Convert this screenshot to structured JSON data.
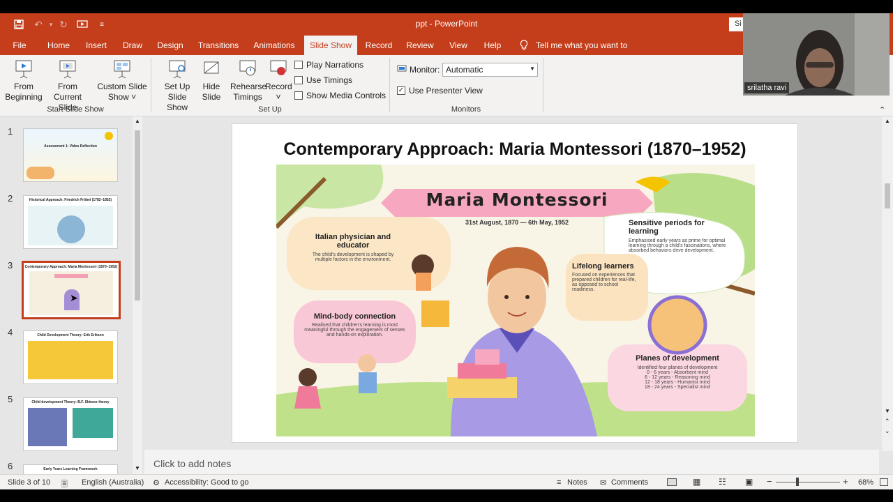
{
  "window": {
    "title": "ppt  -  PowerPoint",
    "signin_label": "Si"
  },
  "tabs": [
    {
      "label": "File"
    },
    {
      "label": "Home"
    },
    {
      "label": "Insert"
    },
    {
      "label": "Draw"
    },
    {
      "label": "Design"
    },
    {
      "label": "Transitions"
    },
    {
      "label": "Animations"
    },
    {
      "label": "Slide Show"
    },
    {
      "label": "Record"
    },
    {
      "label": "Review"
    },
    {
      "label": "View"
    },
    {
      "label": "Help"
    }
  ],
  "tell_me": "Tell me what you want to do",
  "ribbon": {
    "from_beginning": [
      "From",
      "Beginning"
    ],
    "from_current": [
      "From",
      "Current Slide"
    ],
    "custom_show": [
      "Custom Slide",
      "Show ˅"
    ],
    "group_start": "Start Slide Show",
    "set_up": [
      "Set Up",
      "Slide Show"
    ],
    "hide_slide": [
      "Hide",
      "Slide"
    ],
    "rehearse": [
      "Rehearse",
      "Timings"
    ],
    "record": [
      "Record",
      "˅"
    ],
    "play_narrations": "Play Narrations",
    "use_timings": "Use Timings",
    "show_media": "Show Media Controls",
    "group_setup": "Set Up",
    "monitor_label": "Monitor:",
    "monitor_value": "Automatic",
    "use_presenter": "Use Presenter View",
    "group_monitors": "Monitors"
  },
  "webcam": {
    "name": "srilatha ravi"
  },
  "thumbnails": [
    {
      "num": "1",
      "title": "Assessment 1: Video Reflection"
    },
    {
      "num": "2",
      "title": "Historical Approach: Friedrich Fröbel (1782–1852)"
    },
    {
      "num": "3",
      "title": "Contemporary Approach: Maria Montessori (1870–1952)"
    },
    {
      "num": "4",
      "title": "Child Development Theory: Erik Erikson"
    },
    {
      "num": "5",
      "title": "Child development Theory: B.F. Skinner theory"
    },
    {
      "num": "6",
      "title": "Early Years Learning Framework"
    }
  ],
  "slide": {
    "title": "Contemporary Approach: Maria Montessori (1870–1952)",
    "banner": "Maria Montessori",
    "dates": "31st August, 1870 — 6th May, 1952",
    "boxes": [
      {
        "heading": "Italian physician and educator",
        "body": "The child's development is shaped by multiple factors in the environment."
      },
      {
        "heading": "Sensitive periods for learning",
        "body": "Emphasised early years as prime for optimal learning through a child's fascinations, where absorbed behaviors drive development."
      },
      {
        "heading": "Lifelong learners",
        "body": "Focused on experiences that prepared children for real-life, as opposed to school readiness."
      },
      {
        "heading": "Mind-body connection",
        "body": "Realised that children's learning is most meaningful through the engagement of senses and hands-on exploration."
      },
      {
        "heading": "Planes of development",
        "body": "Identified four planes of development",
        "lines": [
          "0 - 6 years - Absorbent mind",
          "6 - 12 years - Reasoning mind",
          "12 - 18 years - Humanist mind",
          "18 - 24 years - Specialist mind"
        ]
      }
    ]
  },
  "notes_placeholder": "Click to add notes",
  "status": {
    "slide_info": "Slide 3 of 10",
    "language": "English (Australia)",
    "accessibility": "Accessibility: Good to go",
    "notes": "Notes",
    "comments": "Comments",
    "zoom": "68%"
  }
}
